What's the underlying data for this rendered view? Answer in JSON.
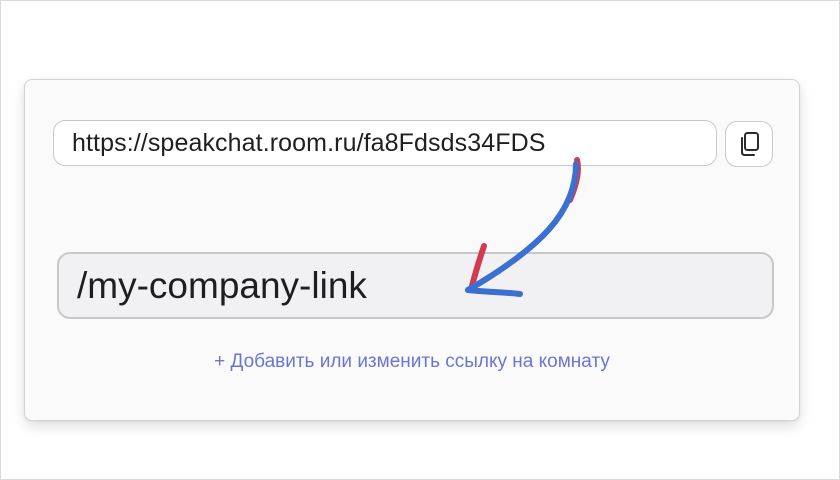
{
  "room_link": {
    "url": "https://speakchat.room.ru/fa8Fdsds34FDS",
    "custom_slug": "/my-company-link",
    "add_change_label": "+ Добавить или изменить ссылку на комнату"
  },
  "icons": {
    "copy": "copy-icon",
    "arrow": "curved-arrow-icon"
  },
  "colors": {
    "link": "#6b76d2",
    "arrow_blue": "#3b6fd0",
    "arrow_red": "#d23a52"
  }
}
